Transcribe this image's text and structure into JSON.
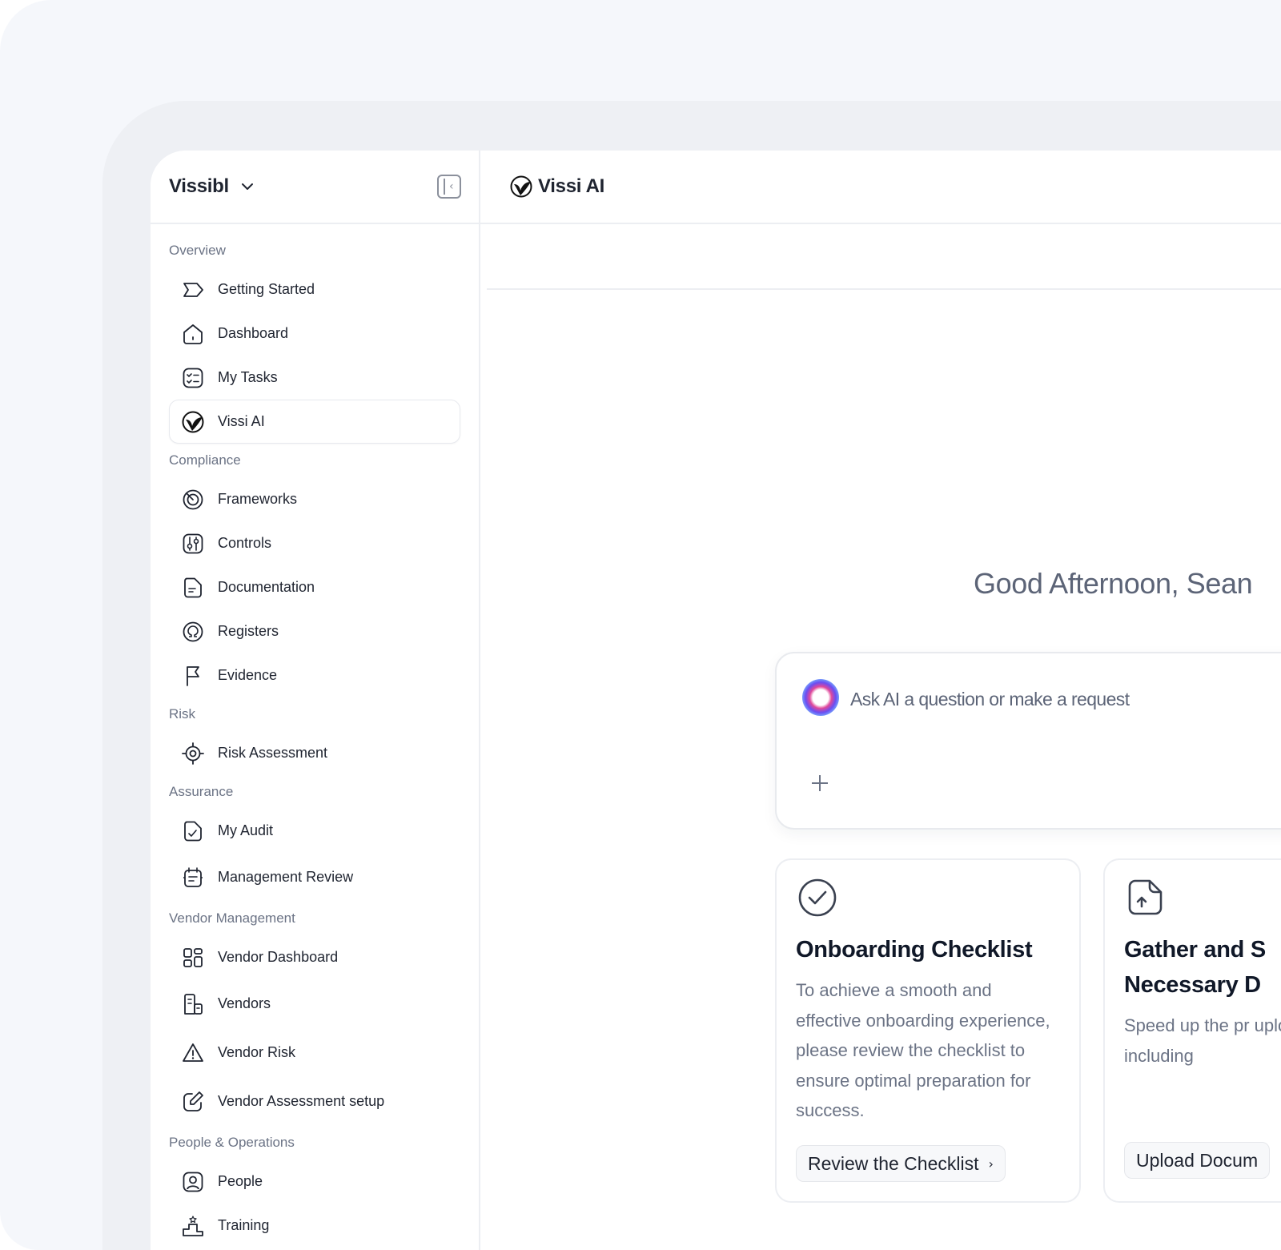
{
  "sidebar": {
    "brand": "Vissibl",
    "sections": [
      {
        "label": "Overview",
        "items": [
          "Getting Started",
          "Dashboard",
          "My Tasks",
          "Vissi AI"
        ]
      },
      {
        "label": "Compliance",
        "items": [
          "Frameworks",
          "Controls",
          "Documentation",
          "Registers",
          "Evidence"
        ]
      },
      {
        "label": "Risk",
        "items": [
          "Risk Assessment"
        ]
      },
      {
        "label": "Assurance",
        "items": [
          "My Audit",
          "Management Review"
        ]
      },
      {
        "label": "Vendor Management",
        "items": [
          "Vendor Dashboard",
          "Vendors",
          "Vendor Risk",
          "Vendor Assessment setup"
        ]
      },
      {
        "label": "People & Operations",
        "items": [
          "People",
          "Training"
        ]
      }
    ],
    "active_item": "Vissi AI"
  },
  "main": {
    "title": "Vissi AI",
    "greeting": "Good Afternoon, Sean",
    "ask": {
      "placeholder": "Ask AI a question or make a request"
    },
    "cards": [
      {
        "title": "Onboarding Checklist",
        "description": "To achieve a smooth and effective onboarding experience, please review the checklist to ensure optimal preparation for success.",
        "button": "Review the Checklist",
        "icon": "check-circle-icon"
      },
      {
        "title": "Gather and S\nNecessary D",
        "description": "Speed up the pr uploading your I including",
        "button": "Upload Docum",
        "icon": "file-upload-icon"
      }
    ]
  },
  "colors": {
    "text": "#1f2430",
    "muted": "#6b7385",
    "border": "#eceef2",
    "background": "#f5f7fb"
  }
}
